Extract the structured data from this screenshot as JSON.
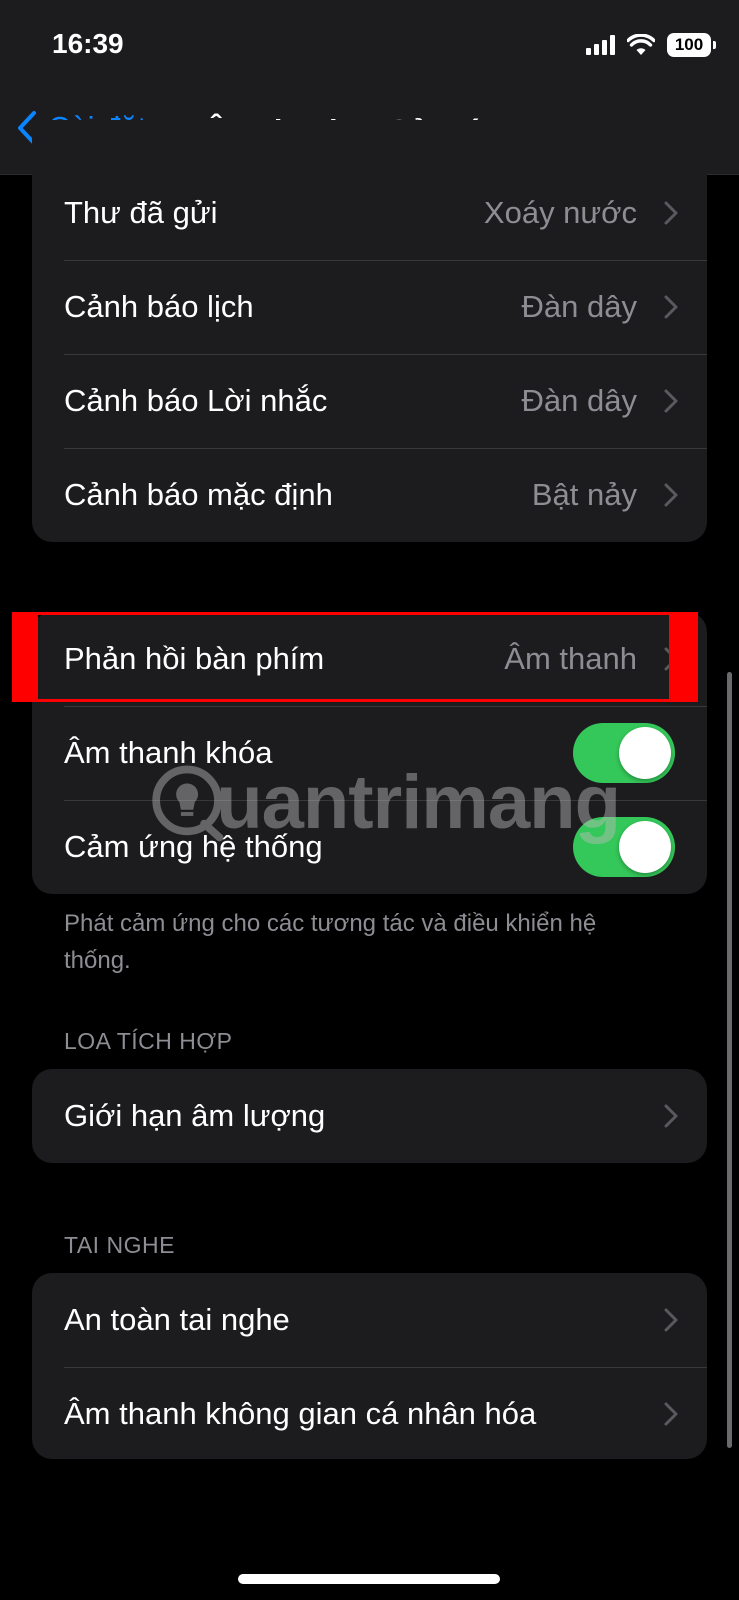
{
  "status_bar": {
    "time": "16:39",
    "battery": "100"
  },
  "nav": {
    "back_label": "Cài đặt",
    "title": "Âm thanh & Cảm ứng"
  },
  "group_alerts": [
    {
      "label": "Thư đã gửi",
      "value": "Xoáy nước"
    },
    {
      "label": "Cảnh báo lịch",
      "value": "Đàn dây"
    },
    {
      "label": "Cảnh báo Lời nhắc",
      "value": "Đàn dây"
    },
    {
      "label": "Cảnh báo mặc định",
      "value": "Bật nảy"
    }
  ],
  "group_feedback": {
    "keyboard": {
      "label": "Phản hồi bàn phím",
      "value": "Âm thanh"
    },
    "lock_sound": {
      "label": "Âm thanh khóa",
      "on": true
    },
    "system_haptics": {
      "label": "Cảm ứng hệ thống",
      "on": true
    },
    "footer": "Phát cảm ứng cho các tương tác và điều khiển hệ thống."
  },
  "built_in_speaker": {
    "header": "LOA TÍCH HỢP",
    "items": [
      {
        "label": "Giới hạn âm lượng"
      }
    ]
  },
  "headphones": {
    "header": "TAI NGHE",
    "items": [
      {
        "label": "An toàn tai nghe"
      },
      {
        "label": "Âm thanh không gian cá nhân hóa"
      }
    ]
  },
  "watermark": {
    "text": "uantrimang"
  },
  "colors": {
    "accent": "#0a84ff",
    "toggle_on": "#34c759",
    "highlight": "#ff0000"
  }
}
